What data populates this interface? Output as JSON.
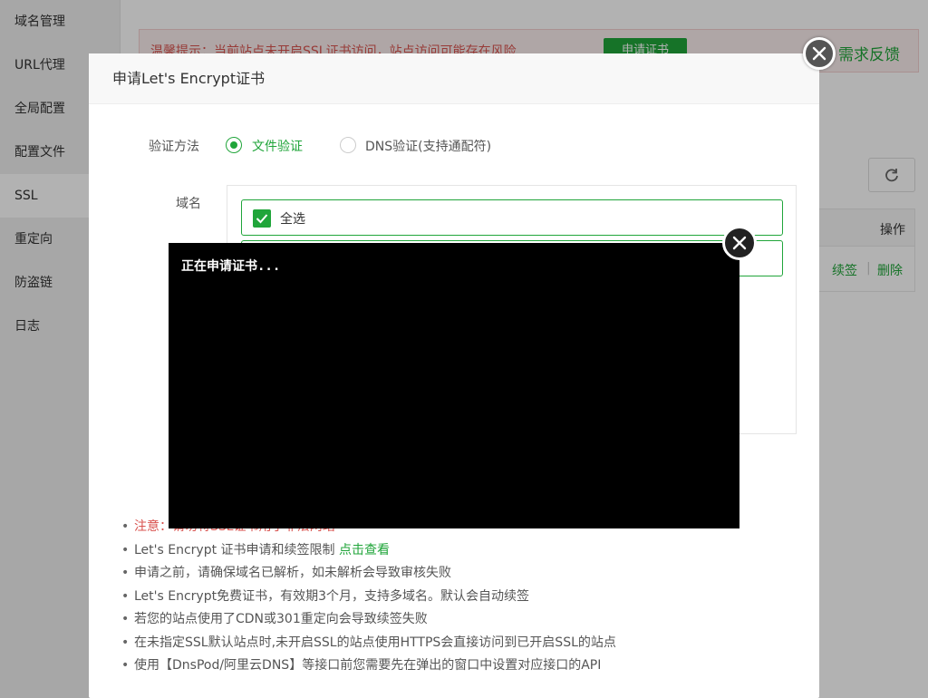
{
  "sidebar": {
    "items": [
      {
        "label": "域名管理"
      },
      {
        "label": "URL代理"
      },
      {
        "label": "全局配置"
      },
      {
        "label": "配置文件"
      },
      {
        "label": "SSL"
      },
      {
        "label": "重定向"
      },
      {
        "label": "防盗链"
      },
      {
        "label": "日志"
      }
    ]
  },
  "background": {
    "warning_text": "温馨提示：当前站点未开启SSL证书访问，站点访问可能存在风险",
    "warning_button": "申请证书",
    "feedback": "需求反馈",
    "table_op_header": "操作",
    "row_renew": "续签",
    "row_delete": "删除"
  },
  "modal": {
    "title": "申请Let's Encrypt证书",
    "verify_label": "验证方法",
    "option_file": "文件验证",
    "option_dns": "DNS验证(支持通配符)",
    "selected": "file",
    "domain_label": "域名",
    "select_all": "全选",
    "select_all_checked": true,
    "notes": {
      "n1_prefix": "注意：",
      "n1_rest": "请勿将SSL证书用于非法网站",
      "n2_text": "Let's Encrypt 证书申请和续签限制 ",
      "n2_link": "点击查看",
      "n3": "申请之前，请确保域名已解析，如未解析会导致审核失败",
      "n4": "Let's Encrypt免费证书，有效期3个月，支持多域名。默认会自动续签",
      "n5": "若您的站点使用了CDN或301重定向会导致续签失败",
      "n6": "在未指定SSL默认站点时,未开启SSL的站点使用HTTPS会直接访问到已开启SSL的站点",
      "n7": "使用【DnsPod/阿里云DNS】等接口前您需要先在弹出的窗口中设置对应接口的API"
    }
  },
  "terminal": {
    "text": "正在申请证书..."
  },
  "colors": {
    "accent": "#20a53a",
    "warning": "#d9534f",
    "terminal_bg": "#000000"
  }
}
